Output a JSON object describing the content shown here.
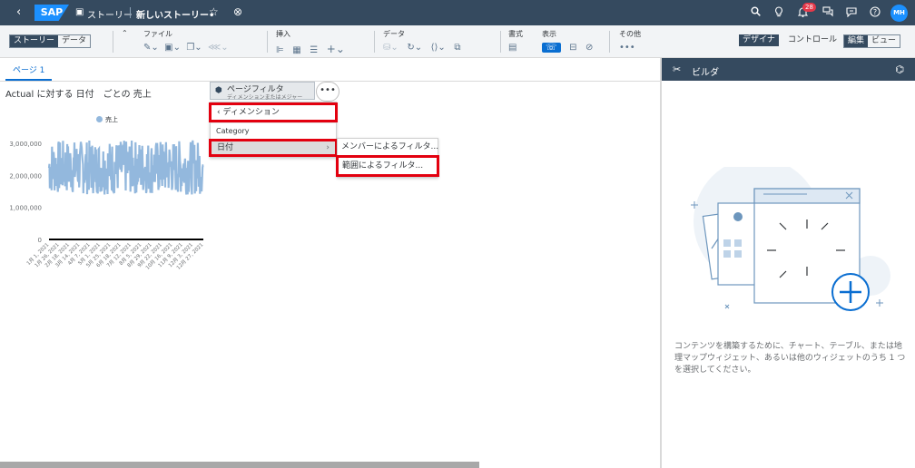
{
  "topbar": {
    "back": "‹",
    "logo": "SAP",
    "story_icon": "▣",
    "story_label": "ストーリー",
    "doc_title": "新しいストーリー•",
    "star": "☆",
    "close": "⊗",
    "notifications_count": "28",
    "avatar": "MH"
  },
  "toolbar": {
    "story_tab": "ストーリー",
    "data_tab": "データ",
    "collapse": "⌃",
    "file": "ファイル",
    "insert": "挿入",
    "data": "データ",
    "format": "書式",
    "view": "表示",
    "other": "その他",
    "other_dots": "•••",
    "designer": "デザイナ",
    "control": "コントロール",
    "edit": "編集",
    "view_mode": "ビュー"
  },
  "tabs": {
    "page1": "ページ 1"
  },
  "chart": {
    "title": "Actual に対する 日付　ごとの 売上",
    "legend": "売上"
  },
  "page_filter": {
    "title": "ページフィルタ",
    "subtitle": "ディメンションまたはメジャー"
  },
  "more_label": "•••",
  "menu": {
    "header": "ディメンション",
    "category": "Category",
    "date": "日付"
  },
  "submenu": {
    "member_filter": "メンバーによるフィルタ...",
    "range_filter": "範囲によるフィルタ..."
  },
  "panel": {
    "title": "ビルダ",
    "description": "コンテンツを構築するために、チャート、テーブル、または地理マップウィジェット、あるいは他のウィジェットのうち 1 つを選択してください。"
  },
  "colors": {
    "shell": "#354a5f",
    "accent": "#0a6ed1",
    "series": "#93b8dd",
    "highlight": "#e3000f"
  },
  "chart_data": {
    "type": "line",
    "title": "Actual に対する 日付　ごとの 売上",
    "series": [
      {
        "name": "売上"
      }
    ],
    "yticks": [
      "3,000,000",
      "2,000,000",
      "1,000,000",
      "0"
    ],
    "ylim": [
      0,
      3000000
    ],
    "xticks": [
      "1月 1, 2021",
      "1月 26, 2021",
      "2月 18, 2021",
      "3月 14, 2021",
      "4月 7, 2021",
      "5月 1, 2021",
      "5月 25, 2021",
      "6月 18, 2021",
      "7月 12, 2021",
      "8月 5, 2021",
      "8月 29, 2021",
      "9月 22, 2021",
      "10月 16, 2021",
      "11月 9, 2021",
      "12月 3, 2021",
      "12月 27, 2021"
    ]
  }
}
